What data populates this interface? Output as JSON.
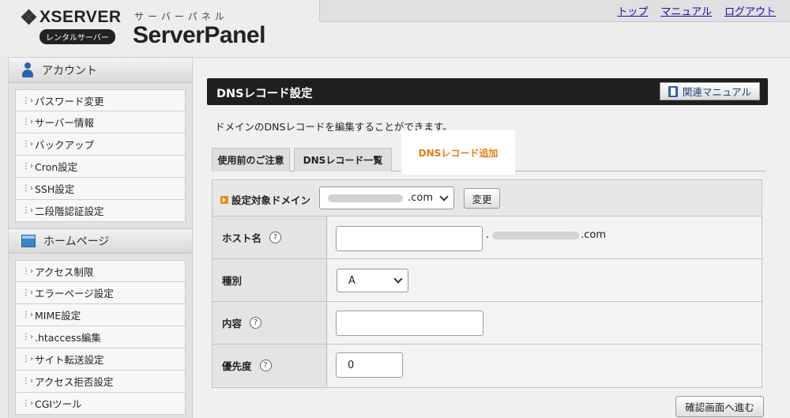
{
  "header": {
    "logo_word": "XSERVER",
    "logo_sub": "レンタルサーバー",
    "brand_kana": "サーバーパネル",
    "brand_name": "ServerPanel",
    "links": [
      "トップ",
      "マニュアル",
      "ログアウト"
    ]
  },
  "sidebar": {
    "account": {
      "title": "アカウント",
      "items": [
        "パスワード変更",
        "サーバー情報",
        "バックアップ",
        "Cron設定",
        "SSH設定",
        "二段階認証設定"
      ]
    },
    "homepage": {
      "title": "ホームページ",
      "items": [
        "アクセス制限",
        "エラーページ設定",
        "MIME設定",
        ".htaccess編集",
        "サイト転送設定",
        "アクセス拒否設定",
        "CGIツール"
      ]
    }
  },
  "main": {
    "title": "DNSレコード設定",
    "manual_button": "関連マニュアル",
    "description": "ドメインのDNSレコードを編集することができます。",
    "tabs": [
      "使用前のご注意",
      "DNSレコード一覧",
      "DNSレコード追加"
    ],
    "active_tab": 2,
    "domain": {
      "label": "設定対象ドメイン",
      "selected_suffix": ".com",
      "change_button": "変更"
    },
    "fields": {
      "host": {
        "label": "ホスト名",
        "help": "?",
        "value": "",
        "suffix_dot": ".",
        "suffix_tld": ".com"
      },
      "type": {
        "label": "種別",
        "selected": "A"
      },
      "content": {
        "label": "内容",
        "help": "?",
        "value": ""
      },
      "priority": {
        "label": "優先度",
        "help": "?",
        "value": "0"
      }
    },
    "confirm_button": "確認画面へ進む"
  },
  "colors": {
    "active_tab": "#e87b12",
    "title_bar": "#1f1f1f",
    "link": "#1a0dab",
    "icon_blue": "#2b61b2"
  }
}
